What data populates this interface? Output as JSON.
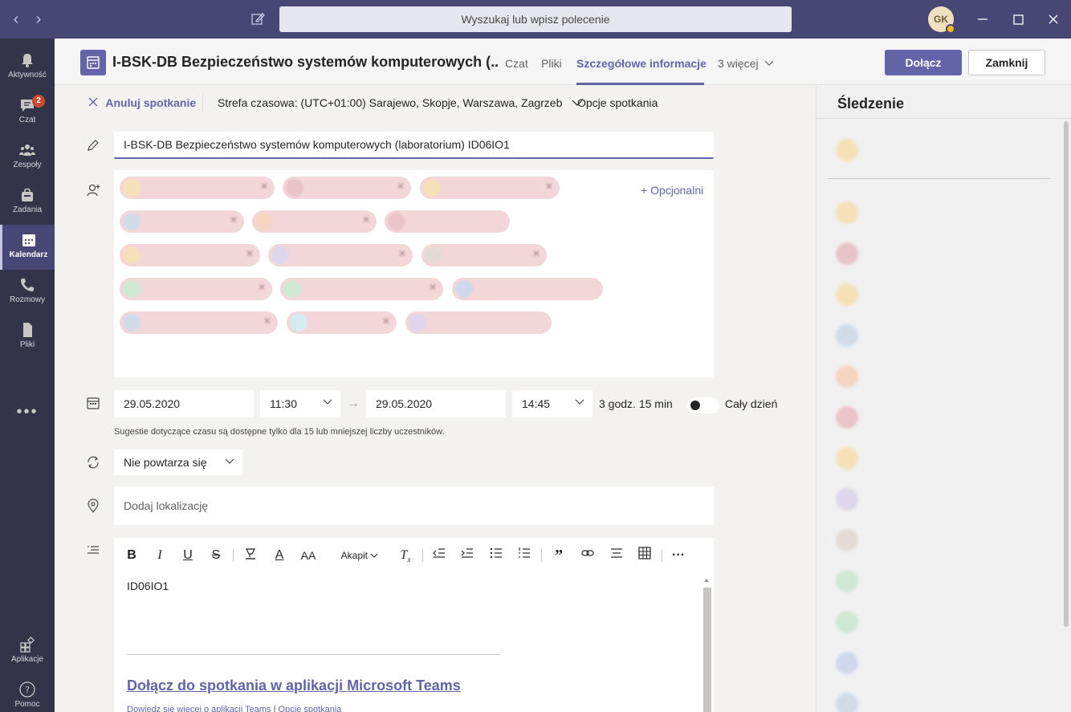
{
  "titlebar": {
    "search_placeholder": "Wyszukaj lub wpisz polecenie",
    "avatar_initials": "GK",
    "status_color": "#fdb913"
  },
  "rail": {
    "items": [
      {
        "label": "Aktywność",
        "icon": "bell-icon"
      },
      {
        "label": "Czat",
        "icon": "chat-icon",
        "badge": "2"
      },
      {
        "label": "Zespoły",
        "icon": "teams-icon"
      },
      {
        "label": "Zadania",
        "icon": "tasks-icon"
      },
      {
        "label": "Kalendarz",
        "icon": "calendar-icon",
        "active": true
      },
      {
        "label": "Rozmowy",
        "icon": "phone-icon"
      },
      {
        "label": "Pliki",
        "icon": "file-icon"
      }
    ],
    "more": "•••",
    "apps_label": "Aplikacje",
    "help_label": "Pomoc"
  },
  "header": {
    "title": "I-BSK-DB Bezpieczeństwo systemów komputerowych (...",
    "tabs": [
      "Czat",
      "Pliki",
      "Szczegółowe informacje",
      "3 więcej"
    ],
    "join_label": "Dołącz",
    "close_label": "Zamknij",
    "accent": "#6264a7"
  },
  "subbar": {
    "cancel_label": "Anuluj spotkanie",
    "timezone_label": "Strefa czasowa: (UTC+01:00) Sarajewo, Skopje, Warszawa, Zagrzeb",
    "options_label": "Opcje spotkania"
  },
  "form": {
    "title_value": "I-BSK-DB Bezpieczeństwo systemów komputerowych (laboratorium) ID06IO1",
    "optional_label": "+ Opcjonalni",
    "start_date": "29.05.2020",
    "start_time": "11:30",
    "end_date": "29.05.2020",
    "end_time": "14:45",
    "duration": "3 godz. 15 min",
    "all_day_label": "Cały dzień",
    "time_hint": "Sugestie dotyczące czasu są dostępne tylko dla 15 lub mniejszej liczby uczestników.",
    "repeat_value": "Nie powtarza się",
    "location_placeholder": "Dodaj lokalizację"
  },
  "editor": {
    "paragraph_label": "Akapit",
    "body_text": "ID06IO1",
    "join_link": "Dołącz do spotkania w aplikacji Microsoft Teams",
    "learn_more": "Dowiedz się więcej o aplikacji Teams",
    "separator": "|",
    "meeting_options": "Opcje spotkania"
  },
  "tracking": {
    "title": "Śledzenie"
  }
}
